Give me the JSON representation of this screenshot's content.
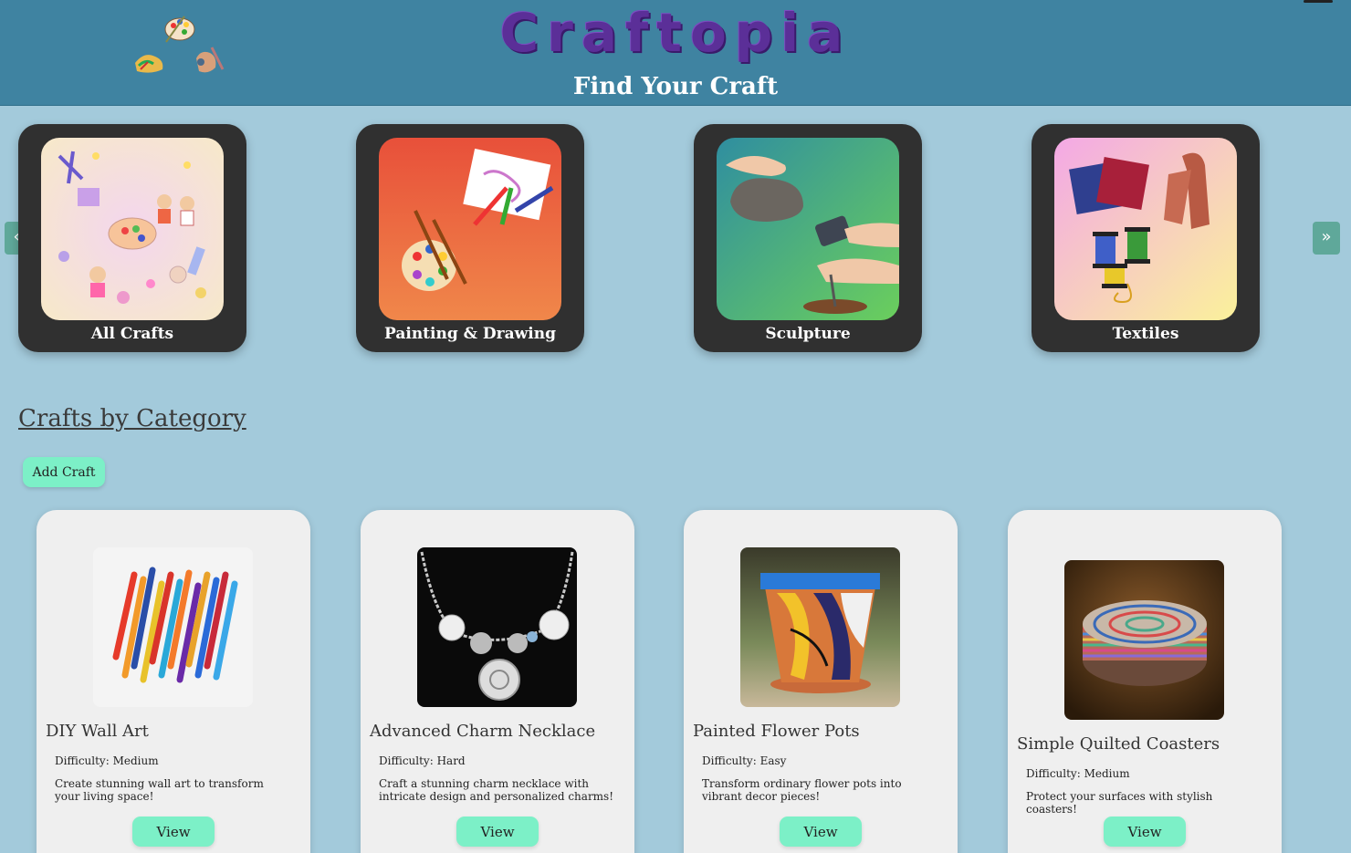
{
  "header": {
    "brand": "Craftopia",
    "tagline": "Find Your Craft"
  },
  "carousel": {
    "prev_label": "«",
    "next_label": "»",
    "categories": [
      {
        "label": "All Crafts"
      },
      {
        "label": "Painting & Drawing"
      },
      {
        "label": "Sculpture"
      },
      {
        "label": "Textiles"
      }
    ]
  },
  "section": {
    "title": "Crafts by Category",
    "add_label": "Add Craft"
  },
  "crafts": [
    {
      "name": "DIY Wall Art",
      "difficulty": "Difficulty: Medium",
      "description": "Create stunning wall art to transform your living space!",
      "view_label": "View"
    },
    {
      "name": "Advanced Charm Necklace",
      "difficulty": "Difficulty: Hard",
      "description": "Craft a stunning charm necklace with intricate design and personalized charms!",
      "view_label": "View"
    },
    {
      "name": "Painted Flower Pots",
      "difficulty": "Difficulty: Easy",
      "description": "Transform ordinary flower pots into vibrant decor pieces!",
      "view_label": "View"
    },
    {
      "name": "Simple Quilted Coasters",
      "difficulty": "Difficulty: Medium",
      "description": "Protect your surfaces with stylish coasters!",
      "view_label": "View"
    }
  ]
}
